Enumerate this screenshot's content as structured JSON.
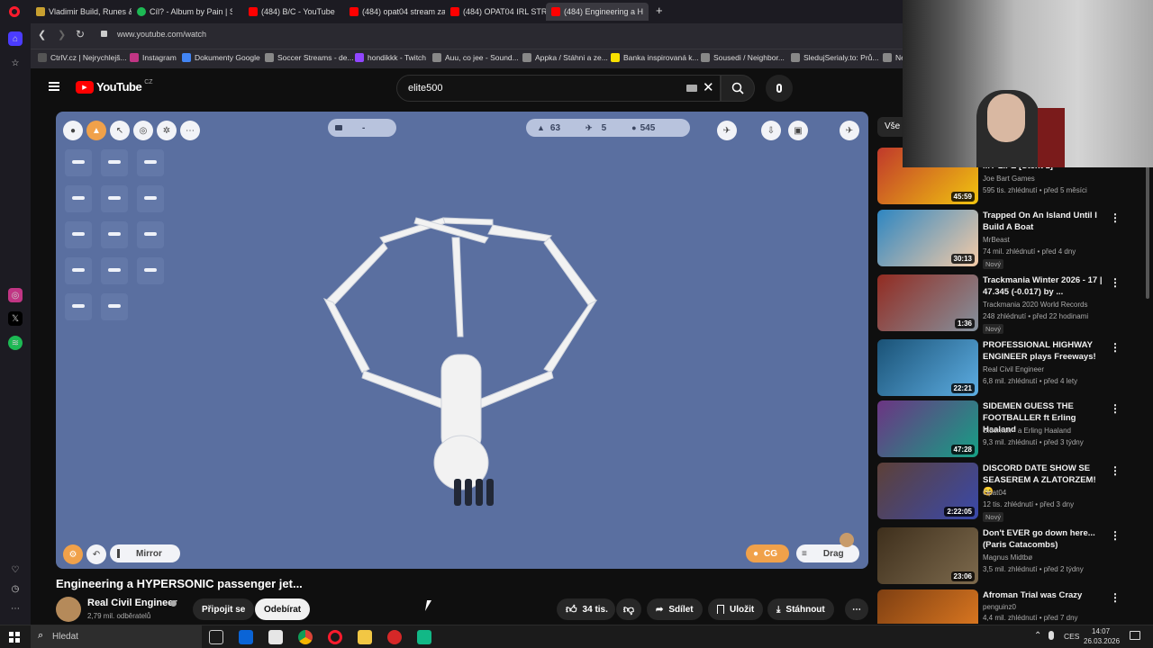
{
  "tabs": [
    {
      "title": "Vladimir Build, Runes & C",
      "color": "#c8a030"
    },
    {
      "title": "Cíl? - Album by Pain | Spo",
      "color": "#1db954"
    },
    {
      "title": "(484) B/C - YouTube",
      "color": "#ff0000"
    },
    {
      "title": "(484) opat04 stream zazn",
      "color": "#ff0000"
    },
    {
      "title": "(484) OPAT04 IRL STREAM",
      "color": "#ff0000"
    },
    {
      "title": "(484) Engineering a H",
      "color": "#ff0000"
    }
  ],
  "new_tab": "+",
  "url": "www.youtube.com/watch",
  "bookmarks": [
    "CtrlV.cz | Nejrychlejš...",
    "Instagram",
    "Dokumenty Google",
    "Soccer Streams - de...",
    "hondikkk - Twitch",
    "Auu, co jee - Sound...",
    "Appka / Stáhni a ze...",
    "Banka inspirovaná k...",
    "Sousedi / Neighbor...",
    "SledujSerialy.to: Prů...",
    "Ne"
  ],
  "yt": {
    "logo": "YouTube",
    "region": "CZ",
    "search_value": "elite500"
  },
  "game": {
    "center_pill": "-",
    "stats": {
      "mass": "63",
      "thrust": "5",
      "coins": "545"
    },
    "mirror_label": "Mirror",
    "cg_label": "CG",
    "drag_label": "Drag"
  },
  "video": {
    "title": "Engineering a HYPERSONIC passenger jet...",
    "channel": "Real Civil Engineer",
    "subscribers": "2,79 mil. odběratelů",
    "join_label": "Připojit se",
    "subscribe_label": "Odebírat",
    "likes": "34 tis.",
    "share_label": "Sdílet",
    "save_label": "Uložit",
    "download_label": "Stáhnout"
  },
  "chip_all": "Vše",
  "recommendations": [
    {
      "title": "MY LIFE [Stent 1]",
      "channel": "Joe Bart Games",
      "meta": "595 tis. zhlédnutí • před 5 měsíci",
      "duration": "45:59",
      "is_new": false,
      "badge": "",
      "colors": [
        "#c0392b",
        "#f1c40f"
      ]
    },
    {
      "title": "Trapped On An Island Until I Build A Boat",
      "channel": "MrBeast",
      "meta": "74 mil. zhlédnutí • před 4 dny",
      "duration": "30:13",
      "is_new": true,
      "badge": "Nový",
      "colors": [
        "#2e86c1",
        "#f5cba7"
      ]
    },
    {
      "title": "Trackmania Winter 2026 - 17 | 47.345 (-0.017) by ...",
      "channel": "Trackmania 2020 World Records",
      "meta": "248 zhlédnutí • před 22 hodinami",
      "duration": "1:36",
      "is_new": true,
      "badge": "Nový",
      "colors": [
        "#922b21",
        "#85929e"
      ]
    },
    {
      "title": "PROFESSIONAL HIGHWAY ENGINEER plays Freeways!",
      "channel": "Real Civil Engineer",
      "meta": "6,8 mil. zhlédnutí • před 4 lety",
      "duration": "22:21",
      "is_new": false,
      "badge": "",
      "colors": [
        "#1a5276",
        "#5dade2"
      ]
    },
    {
      "title": "SIDEMEN GUESS THE FOOTBALLER ft Erling Haaland",
      "channel": "Sidemen • a Erling Haaland",
      "meta": "9,3 mil. zhlédnutí • před 3 týdny",
      "duration": "47:28",
      "is_new": false,
      "badge": "",
      "colors": [
        "#6c3483",
        "#16a085"
      ]
    },
    {
      "title": "DISCORD DATE SHOW SE SEASEREM A ZLATORZEM! 😄",
      "channel": "Opat04",
      "meta": "12 tis. zhlédnutí • před 3 dny",
      "duration": "2:22:05",
      "is_new": true,
      "badge": "Nový",
      "colors": [
        "#5d4037",
        "#3949ab"
      ]
    },
    {
      "title": "Don't EVER go down here... (Paris Catacombs)",
      "channel": "Magnus Midtbø",
      "meta": "3,5 mil. zhlédnutí • před 2 týdny",
      "duration": "23:06",
      "is_new": false,
      "badge": "",
      "colors": [
        "#3e2f1c",
        "#7d6a4d"
      ]
    },
    {
      "title": "Afroman Trial was Crazy",
      "channel": "penguinz0",
      "meta": "4,4 mil. zhlédnutí • před 7 dny",
      "duration": "",
      "is_new": false,
      "badge": "",
      "colors": [
        "#7e3f12",
        "#e67e22"
      ]
    }
  ],
  "taskbar": {
    "search_placeholder": "Hledat",
    "lang": "CES",
    "time": "14:07",
    "date": "26.03.2026"
  }
}
